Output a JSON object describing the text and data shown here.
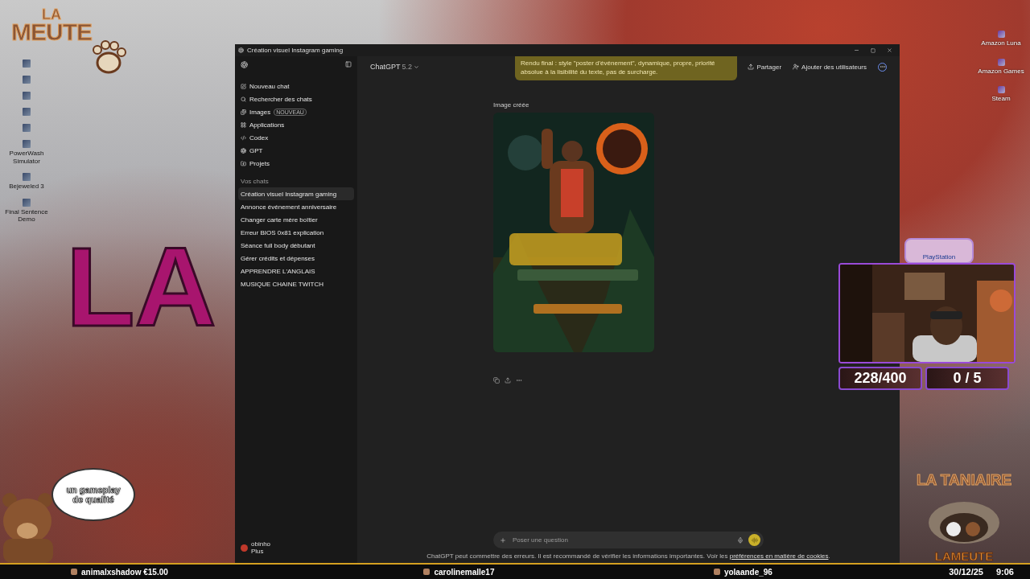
{
  "desktop_icons": [
    {
      "kind": "app"
    },
    {
      "kind": "app"
    },
    {
      "kind": "app"
    },
    {
      "kind": "app"
    },
    {
      "kind": "app"
    },
    {
      "kind": "app",
      "label": "PowerWash Simulator"
    },
    {
      "kind": "app",
      "label": "Bejeweled 3"
    },
    {
      "kind": "app",
      "label": "Final Sentence Demo"
    }
  ],
  "stream_logo": {
    "top": "LA",
    "bottom": "MEUTE"
  },
  "overlay_art_text": "LA",
  "speech_bubble": "un gameplay de qualité",
  "window": {
    "title": "Création visuel Instagram gaming"
  },
  "sidebar": {
    "nav": [
      {
        "label": "Nouveau chat",
        "kind": "new"
      },
      {
        "label": "Rechercher des chats",
        "kind": "search"
      },
      {
        "label": "Images",
        "kind": "images",
        "badge": "NOUVEAU"
      },
      {
        "label": "Applications",
        "kind": "apps"
      },
      {
        "label": "Codex",
        "kind": "codex"
      },
      {
        "label": "GPT",
        "kind": "gpt"
      },
      {
        "label": "Projets",
        "kind": "projects"
      }
    ],
    "section": "Vos chats",
    "chats": [
      {
        "label": "Création visuel Instagram gaming",
        "selected": true
      },
      {
        "label": "Annonce événement anniversaire",
        "selected": false
      },
      {
        "label": "Changer carte mère boîtier",
        "selected": false
      },
      {
        "label": "Erreur BIOS 0x81 explication",
        "selected": false
      },
      {
        "label": "Séance full body débutant",
        "selected": false
      },
      {
        "label": "Gérer crédits et dépenses",
        "selected": false
      },
      {
        "label": "APPRENDRE L'ANGLAIS",
        "selected": false
      },
      {
        "label": "MUSIQUE CHAINE TWITCH",
        "selected": false
      }
    ],
    "user": {
      "name": "obinho",
      "plan": "Plus"
    }
  },
  "header": {
    "model": "ChatGPT",
    "version": "5.2",
    "share": "Partager",
    "add_users": "Ajouter des utilisateurs"
  },
  "tooltip": "Rendu final : style \"poster d'événement\", dynamique, propre, priorité absolue à la lisibilité du texte, pas de surcharge.",
  "message": {
    "label": "Image créée"
  },
  "composer": {
    "placeholder": "Poser une question"
  },
  "disclaimer": {
    "text": "ChatGPT peut commettre des erreurs. Il est recommandé de vérifier les informations importantes. Voir les",
    "link": "préférences en matière de cookies",
    "end": "."
  },
  "playstation_label": "PlayStation",
  "counters": [
    "228/400",
    "0 / 5"
  ],
  "right_icons": [
    {
      "label": "Amazon Luna"
    },
    {
      "label": "Amazon Games"
    },
    {
      "label": "Steam"
    }
  ],
  "corner_logo": {
    "top": "LA TANIAIRE",
    "bottom": "LAMEUTE"
  },
  "ticker": {
    "items": [
      "animalxshadow €15.00",
      "carolinemalle17",
      "yolaande_96"
    ],
    "date": "30/12/25",
    "time": "9:06"
  }
}
